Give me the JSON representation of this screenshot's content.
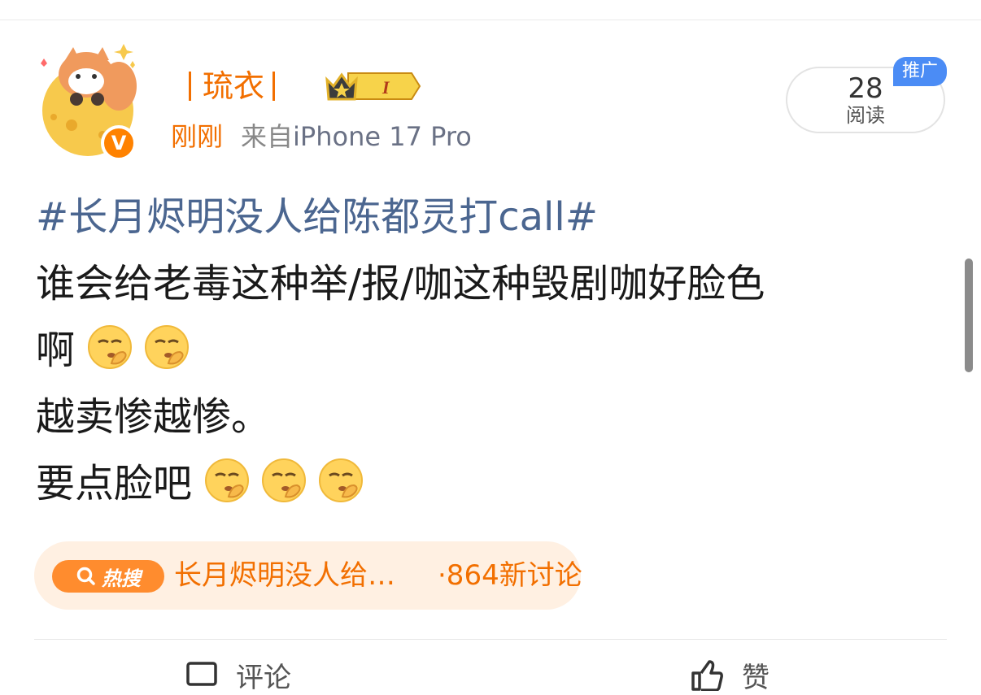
{
  "user": {
    "name": "琉衣",
    "vip_level": "I",
    "verified_badge": "V"
  },
  "post_meta": {
    "time": "刚刚",
    "source_prefix": "来自",
    "device": "iPhone 17 Pro"
  },
  "stats": {
    "read_count": "28",
    "read_label": "阅读",
    "promo_tag": "推广"
  },
  "post": {
    "hashtag": "#长月烬明没人给陈都灵打call#",
    "line1": "谁会给老毒这种举/报/咖这种毁剧咖好脸色",
    "line2": "啊",
    "line3": "越卖惨越惨。",
    "line4": "要点脸吧",
    "emoji_name": "shush-emoji"
  },
  "hot_search": {
    "label": "热搜",
    "topic": "长月烬明没人给…",
    "count": "·864新讨论"
  },
  "actions": {
    "comment": "评论",
    "like": "赞"
  },
  "colors": {
    "accent_orange": "#f26f00",
    "hashtag_blue": "#4b6690",
    "promo_blue": "#4b8cf5",
    "hot_bg": "#fff0e2"
  }
}
